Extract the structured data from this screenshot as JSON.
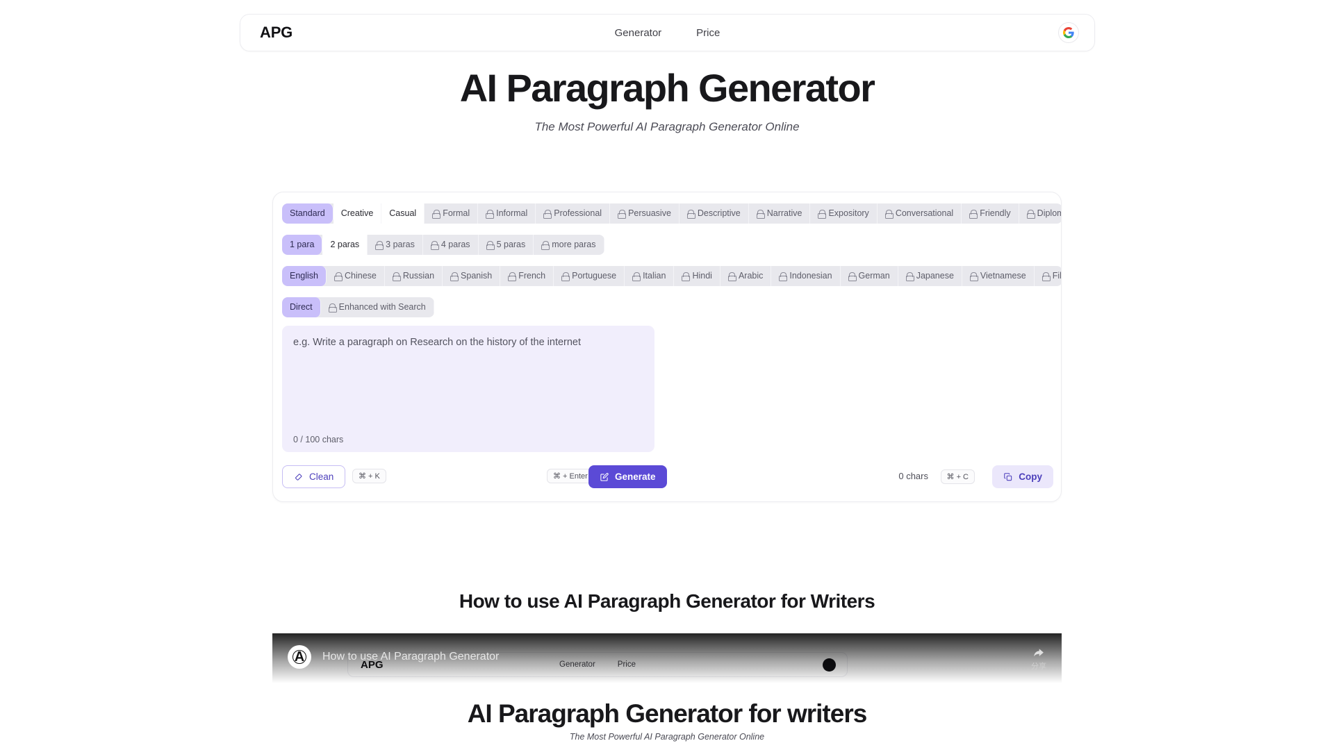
{
  "header": {
    "brand": "APG",
    "nav": [
      {
        "label": "Generator"
      },
      {
        "label": "Price"
      }
    ],
    "account_icon": "google-icon"
  },
  "hero": {
    "title": "AI Paragraph Generator",
    "subtitle": "The Most Powerful AI Paragraph Generator Online"
  },
  "generator": {
    "tone_options": [
      {
        "label": "Standard",
        "state": "active",
        "locked": false
      },
      {
        "label": "Creative",
        "state": "plain",
        "locked": false
      },
      {
        "label": "Casual",
        "state": "plain",
        "locked": false
      },
      {
        "label": "Formal",
        "state": "muted",
        "locked": true
      },
      {
        "label": "Informal",
        "state": "muted",
        "locked": true
      },
      {
        "label": "Professional",
        "state": "muted",
        "locked": true
      },
      {
        "label": "Persuasive",
        "state": "muted",
        "locked": true
      },
      {
        "label": "Descriptive",
        "state": "muted",
        "locked": true
      },
      {
        "label": "Narrative",
        "state": "muted",
        "locked": true
      },
      {
        "label": "Expository",
        "state": "muted",
        "locked": true
      },
      {
        "label": "Conversational",
        "state": "muted",
        "locked": true
      },
      {
        "label": "Friendly",
        "state": "muted",
        "locked": true
      },
      {
        "label": "Diplomatic",
        "state": "muted",
        "locked": true
      }
    ],
    "length_options": [
      {
        "label": "1 para",
        "state": "active",
        "locked": false
      },
      {
        "label": "2 paras",
        "state": "plain",
        "locked": false
      },
      {
        "label": "3 paras",
        "state": "muted",
        "locked": true
      },
      {
        "label": "4 paras",
        "state": "muted",
        "locked": true
      },
      {
        "label": "5 paras",
        "state": "muted",
        "locked": true
      },
      {
        "label": "more paras",
        "state": "muted",
        "locked": true
      }
    ],
    "language_options": [
      {
        "label": "English",
        "state": "active",
        "locked": false
      },
      {
        "label": "Chinese",
        "state": "muted",
        "locked": true
      },
      {
        "label": "Russian",
        "state": "muted",
        "locked": true
      },
      {
        "label": "Spanish",
        "state": "muted",
        "locked": true
      },
      {
        "label": "French",
        "state": "muted",
        "locked": true
      },
      {
        "label": "Portuguese",
        "state": "muted",
        "locked": true
      },
      {
        "label": "Italian",
        "state": "muted",
        "locked": true
      },
      {
        "label": "Hindi",
        "state": "muted",
        "locked": true
      },
      {
        "label": "Arabic",
        "state": "muted",
        "locked": true
      },
      {
        "label": "Indonesian",
        "state": "muted",
        "locked": true
      },
      {
        "label": "German",
        "state": "muted",
        "locked": true
      },
      {
        "label": "Japanese",
        "state": "muted",
        "locked": true
      },
      {
        "label": "Vietnamese",
        "state": "muted",
        "locked": true
      },
      {
        "label": "Filipino",
        "state": "muted",
        "locked": true
      }
    ],
    "mode_options": [
      {
        "label": "Direct",
        "state": "active",
        "locked": false
      },
      {
        "label": "Enhanced with Search",
        "state": "muted",
        "locked": true
      }
    ],
    "input": {
      "value": "",
      "placeholder": "e.g. Write a paragraph on Research on the history of the internet",
      "char_count": "0 / 100 chars"
    },
    "actions": {
      "clean_label": "Clean",
      "clean_icon": "eraser-icon",
      "clean_shortcut": "⌘ + K",
      "generate_label": "Generate",
      "generate_icon": "edit-square-icon",
      "generate_shortcut": "⌘ + Enter",
      "output_chars": "0 chars",
      "copy_label": "Copy",
      "copy_icon": "copy-icon",
      "copy_shortcut": "⌘ + C"
    }
  },
  "video_section": {
    "heading": "How to use AI Paragraph Generator for Writers",
    "player": {
      "title": "How to use AI Paragraph Generator",
      "channel_avatar_letter": "A",
      "share_label": "分享",
      "share_icon": "share-arrow-icon"
    },
    "frame": {
      "brand": "APG",
      "nav": [
        {
          "label": "Generator"
        },
        {
          "label": "Price"
        }
      ],
      "title": "AI Paragraph Generator for writers",
      "subtitle": "The Most Powerful AI Paragraph Generator Online"
    }
  },
  "colors": {
    "accent": "#5b4ad6",
    "accent_soft": "#c9bffa",
    "accent_tint": "#ebe7fb",
    "input_bg": "#f1eefc",
    "segment_bg": "#e8e8ed"
  }
}
